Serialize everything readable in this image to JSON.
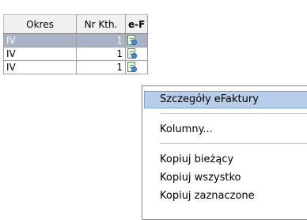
{
  "grid": {
    "columns": [
      "Okres",
      "Nr Kth.",
      "e-F"
    ],
    "rows": [
      {
        "okres": "IV",
        "nr": "1",
        "icon": "document-search-icon",
        "selected": true
      },
      {
        "okres": "IV",
        "nr": "1",
        "icon": "document-search-icon",
        "selected": false
      },
      {
        "okres": "IV",
        "nr": "1",
        "icon": "document-search-icon",
        "selected": false
      }
    ]
  },
  "context_menu": {
    "items": [
      {
        "label": "Szczegóły eFaktury",
        "highlighted": true
      },
      {
        "label": "Kolumny..."
      },
      {
        "label": "Kopiuj bieżący"
      },
      {
        "label": "Kopiuj wszystko"
      },
      {
        "label": "Kopiuj zaznaczone"
      }
    ]
  },
  "colors": {
    "selection": "#a9b3c6",
    "menu_highlight": "#b8cdea"
  }
}
